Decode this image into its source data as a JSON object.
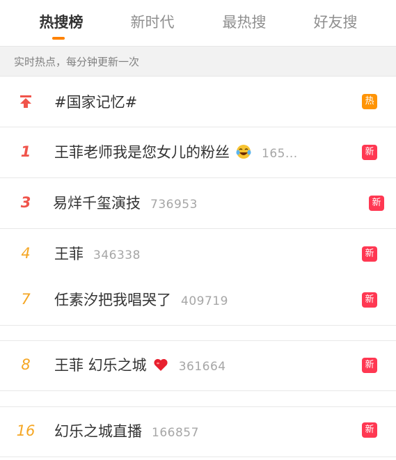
{
  "tabs": [
    {
      "label": "热搜榜",
      "active": true
    },
    {
      "label": "新时代",
      "active": false
    },
    {
      "label": "最热搜",
      "active": false
    },
    {
      "label": "好友搜",
      "active": false
    }
  ],
  "section_header": "实时热点，每分钟更新一次",
  "colors": {
    "accent": "#ff8200",
    "rank_top": "#f0544b",
    "rank_normal": "#f5a623",
    "badge_hot": "#ff9406",
    "badge_new": "#ff3852"
  },
  "rows": [
    {
      "rank_icon": "pin-top-icon",
      "rank": "",
      "title": "#国家记忆#",
      "count": "",
      "emoji": "",
      "badge": "热",
      "badge_type": "hot"
    },
    {
      "rank": "1",
      "title": "王菲老师我是您女儿的粉丝",
      "emoji": "laughing-tears-emoji-icon",
      "count": "165...",
      "badge": "新",
      "badge_type": "new"
    },
    {
      "rank": "3",
      "title": "易烊千玺演技",
      "count": "736953",
      "emoji": "",
      "badge": "新",
      "badge_type": "new"
    },
    {
      "rank": "4",
      "title": "王菲",
      "count": "346338",
      "emoji": "",
      "badge": "新",
      "badge_type": "new"
    },
    {
      "rank": "7",
      "title": "任素汐把我唱哭了",
      "count": "409719",
      "emoji": "",
      "badge": "新",
      "badge_type": "new"
    },
    {
      "rank": "8",
      "title": "王菲 幻乐之城",
      "emoji": "heart-icon",
      "count": "361664",
      "badge": "新",
      "badge_type": "new"
    },
    {
      "rank": "16",
      "title": "幻乐之城直播",
      "count": "166857",
      "emoji": "",
      "badge": "新",
      "badge_type": "new"
    }
  ]
}
